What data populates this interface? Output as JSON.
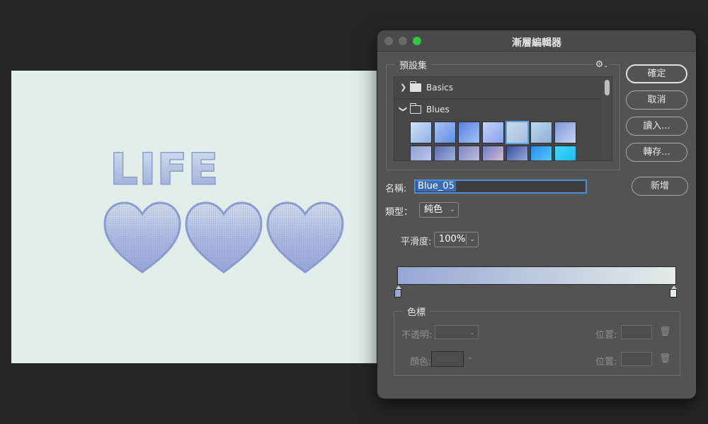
{
  "canvas": {
    "life_text": "LIFE",
    "hearts": [
      "heart",
      "heart",
      "heart"
    ]
  },
  "dialog": {
    "title": "漸層編輯器",
    "window_controls": [
      "close",
      "minimize",
      "maximize"
    ]
  },
  "presets": {
    "legend": "預設集",
    "gear_icon": "gear-icon",
    "folders": [
      {
        "label": "Basics",
        "expanded": false
      },
      {
        "label": "Blues",
        "expanded": true
      }
    ],
    "swatches": [
      [
        "#cfe0f5",
        "#8eb3ea"
      ],
      [
        "#a6c3f2",
        "#5f8fe6"
      ],
      [
        "#5b7fe0",
        "#a2c3f5"
      ],
      [
        "#c0d4f5",
        "#8c9ff0"
      ],
      [
        "#c9dbe8",
        "#a6bddf"
      ],
      [
        "#bfd6ea",
        "#8ab0d8"
      ],
      [
        "#7d95d8",
        "#c5d6f0"
      ],
      [
        "#8da0d2",
        "#c3cdf0"
      ],
      [
        "#5a70b0",
        "#adbde6"
      ],
      [
        "#8088c0",
        "#c8c4e6"
      ],
      [
        "#6d7fc6",
        "#e6c4d6"
      ],
      [
        "#3a4f9c",
        "#a8bce6"
      ],
      [
        "#2a8cf0",
        "#5ad6f8"
      ],
      [
        "#3fd8f8",
        "#1ab8f0"
      ]
    ],
    "selected_swatch_index": 4
  },
  "buttons": {
    "ok": "確定",
    "cancel": "取消",
    "load": "讀入...",
    "save": "轉存...",
    "new": "新增"
  },
  "form": {
    "name_label": "名稱:",
    "name_value": "Blue_05",
    "type_label": "類型：",
    "type_value": "純色",
    "smoothness_label": "平滑度:",
    "smoothness_value": "100%"
  },
  "gradient": {
    "start_color": "#96a7d4",
    "end_color": "#e4ece8"
  },
  "color_stops": {
    "legend": "色標",
    "opacity_label": "不透明:",
    "color_label": "顏色:",
    "location_label_1": "位置:",
    "location_label_2": "位置:"
  }
}
